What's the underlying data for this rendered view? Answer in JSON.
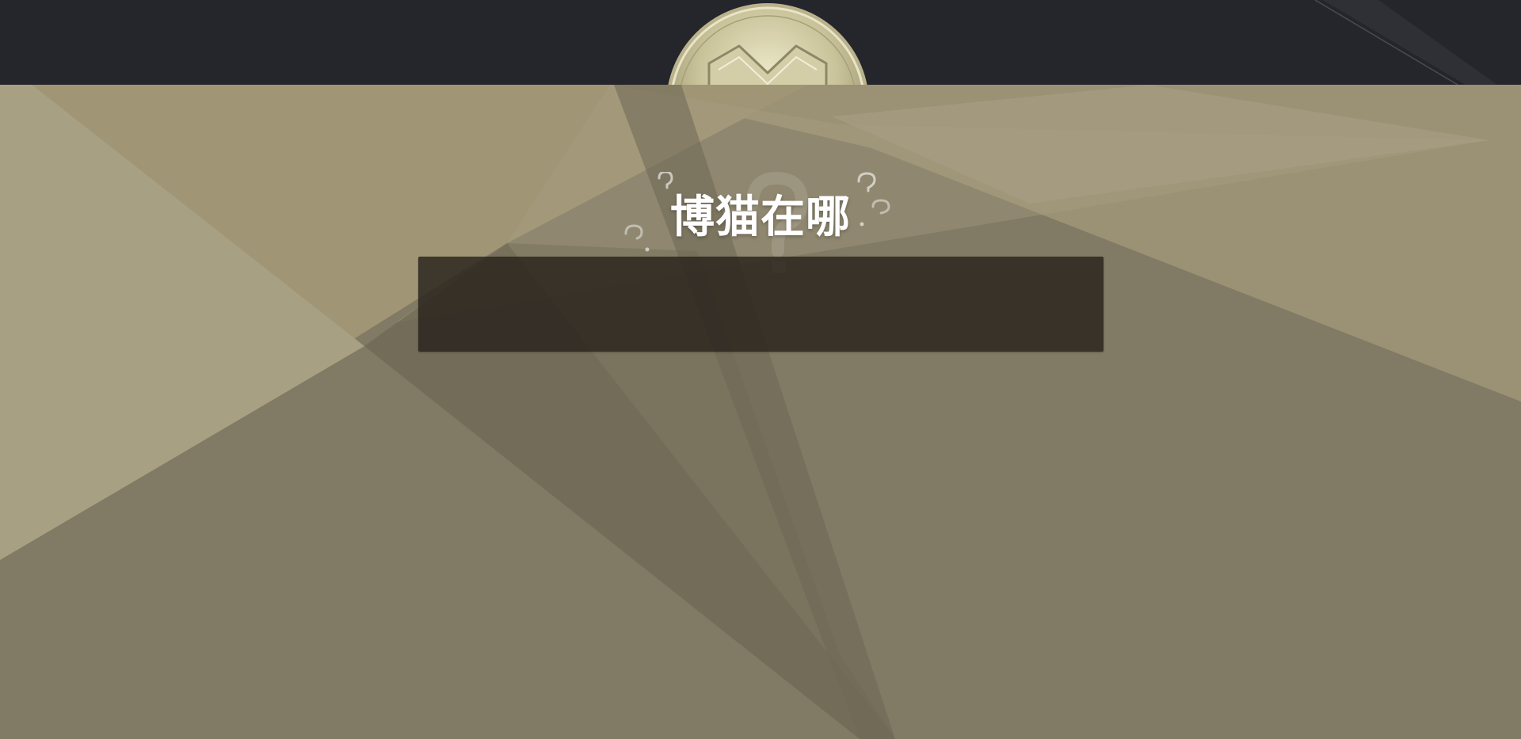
{
  "page": {
    "title": "博猫在哪"
  },
  "logo": {
    "icon": "m-coin-logo"
  },
  "decor": {
    "icon": "question-marks-icon"
  },
  "colors": {
    "header_bg": "#25252c",
    "main_bg": "#817a65",
    "light_facet": "#a8a083",
    "gold_facet": "#9e9473",
    "dark_facet": "#6d6653",
    "panel_bg": "#3a332b",
    "title_text": "#ffffff"
  }
}
